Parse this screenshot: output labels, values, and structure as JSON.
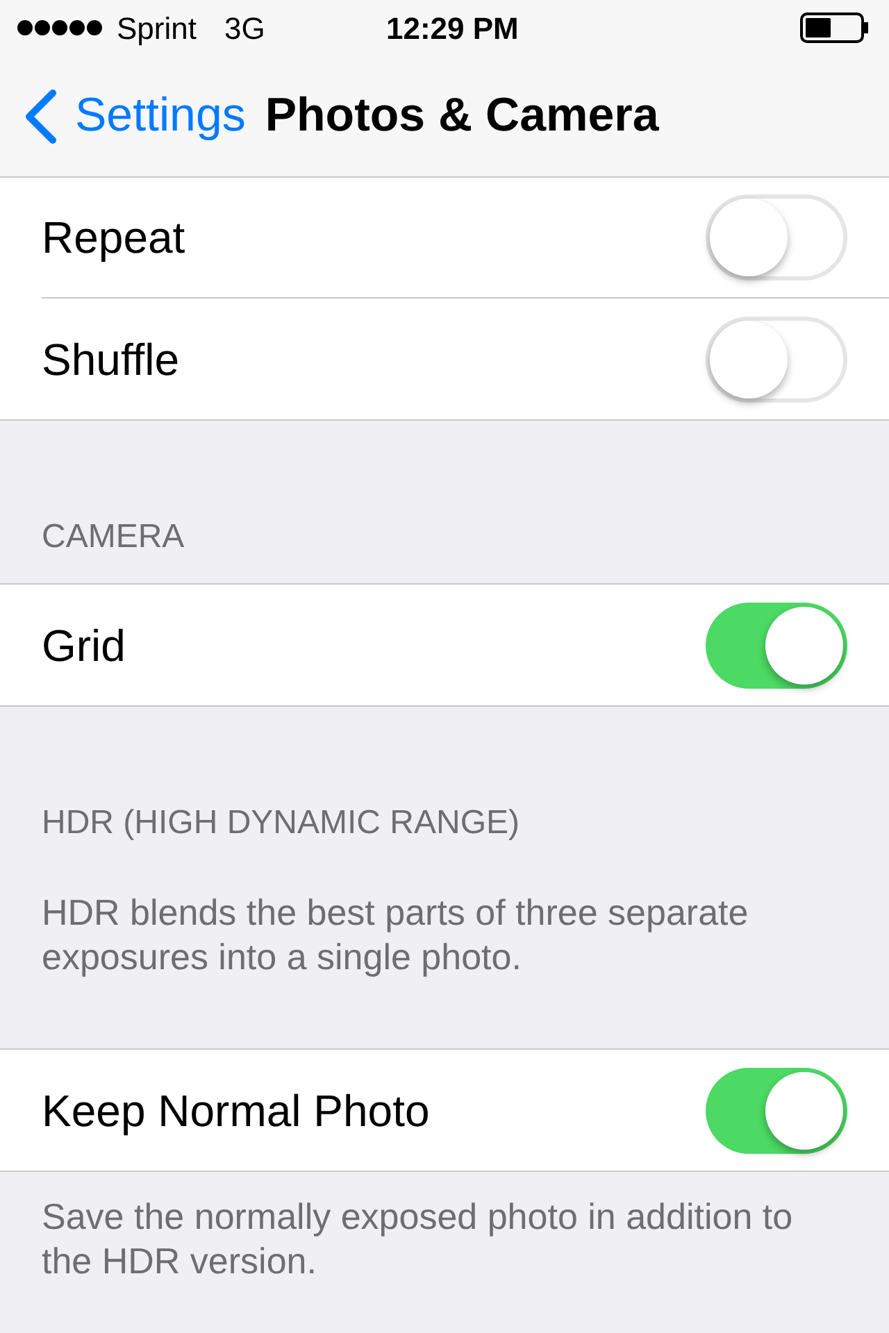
{
  "status_bar": {
    "carrier": "Sprint",
    "network": "3G",
    "time": "12:29 PM"
  },
  "nav_bar": {
    "back_label": "Settings",
    "title": "Photos & Camera"
  },
  "sections": [
    {
      "rows": [
        {
          "label": "Repeat",
          "on": false
        },
        {
          "label": "Shuffle",
          "on": false
        }
      ]
    },
    {
      "header": "CAMERA",
      "rows": [
        {
          "label": "Grid",
          "on": true
        }
      ]
    },
    {
      "header": "HDR (HIGH DYNAMIC RANGE)",
      "note": "HDR blends the best parts of three separate exposures into a single photo.",
      "rows": [
        {
          "label": "Keep Normal Photo",
          "on": true
        }
      ],
      "footer": "Save the normally exposed photo in addition to the HDR version."
    }
  ]
}
